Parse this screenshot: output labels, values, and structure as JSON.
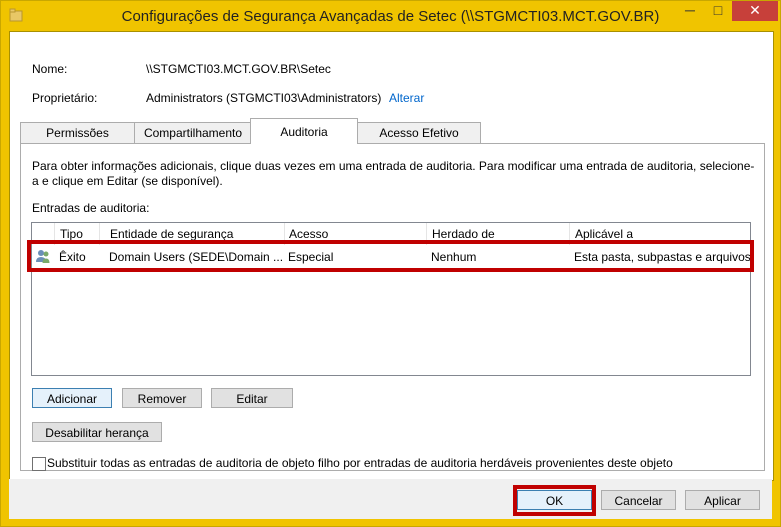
{
  "window": {
    "title": "Configurações de Segurança Avançadas de Setec (\\\\STGMCTI03.MCT.GOV.BR)",
    "minimize_label": "─",
    "maximize_label": "□",
    "close_label": "✕"
  },
  "info": {
    "name_label": "Nome:",
    "name_value": "\\\\STGMCTI03.MCT.GOV.BR\\Setec",
    "owner_label": "Proprietário:",
    "owner_value": "Administrators (STGMCTI03\\Administrators)",
    "change_link": "Alterar"
  },
  "tabs": [
    {
      "label": "Permissões",
      "active": false
    },
    {
      "label": "Compartilhamento",
      "active": false
    },
    {
      "label": "Auditoria",
      "active": true
    },
    {
      "label": "Acesso Efetivo",
      "active": false
    }
  ],
  "auditoria": {
    "description": "Para obter informações adicionais, clique duas vezes em uma entrada de auditoria. Para modificar uma entrada de auditoria, selecione-a e clique em Editar (se disponível).",
    "entries_label": "Entradas de auditoria:",
    "columns": [
      "Tipo",
      "Entidade de segurança",
      "Acesso",
      "Herdado de",
      "Aplicável a"
    ],
    "rows": [
      {
        "icon": "users-icon",
        "tipo": "Êxito",
        "entidade": "Domain Users (SEDE\\Domain ...",
        "acesso": "Especial",
        "herdado": "Nenhum",
        "aplicavel": "Esta pasta, subpastas e arquivos"
      }
    ],
    "buttons": {
      "add": "Adicionar",
      "remove": "Remover",
      "edit": "Editar",
      "disable_inheritance": "Desabilitar herança"
    },
    "replace_checkbox_label": "Substituir todas as entradas de auditoria de objeto filho por entradas de auditoria herdáveis provenientes deste objeto",
    "replace_checked": false
  },
  "footer": {
    "ok": "OK",
    "cancel": "Cancelar",
    "apply": "Aplicar"
  },
  "colors": {
    "highlight": "#c00000",
    "window_frame": "#f0c400",
    "link": "#0066cc",
    "close_button": "#c7403a"
  }
}
